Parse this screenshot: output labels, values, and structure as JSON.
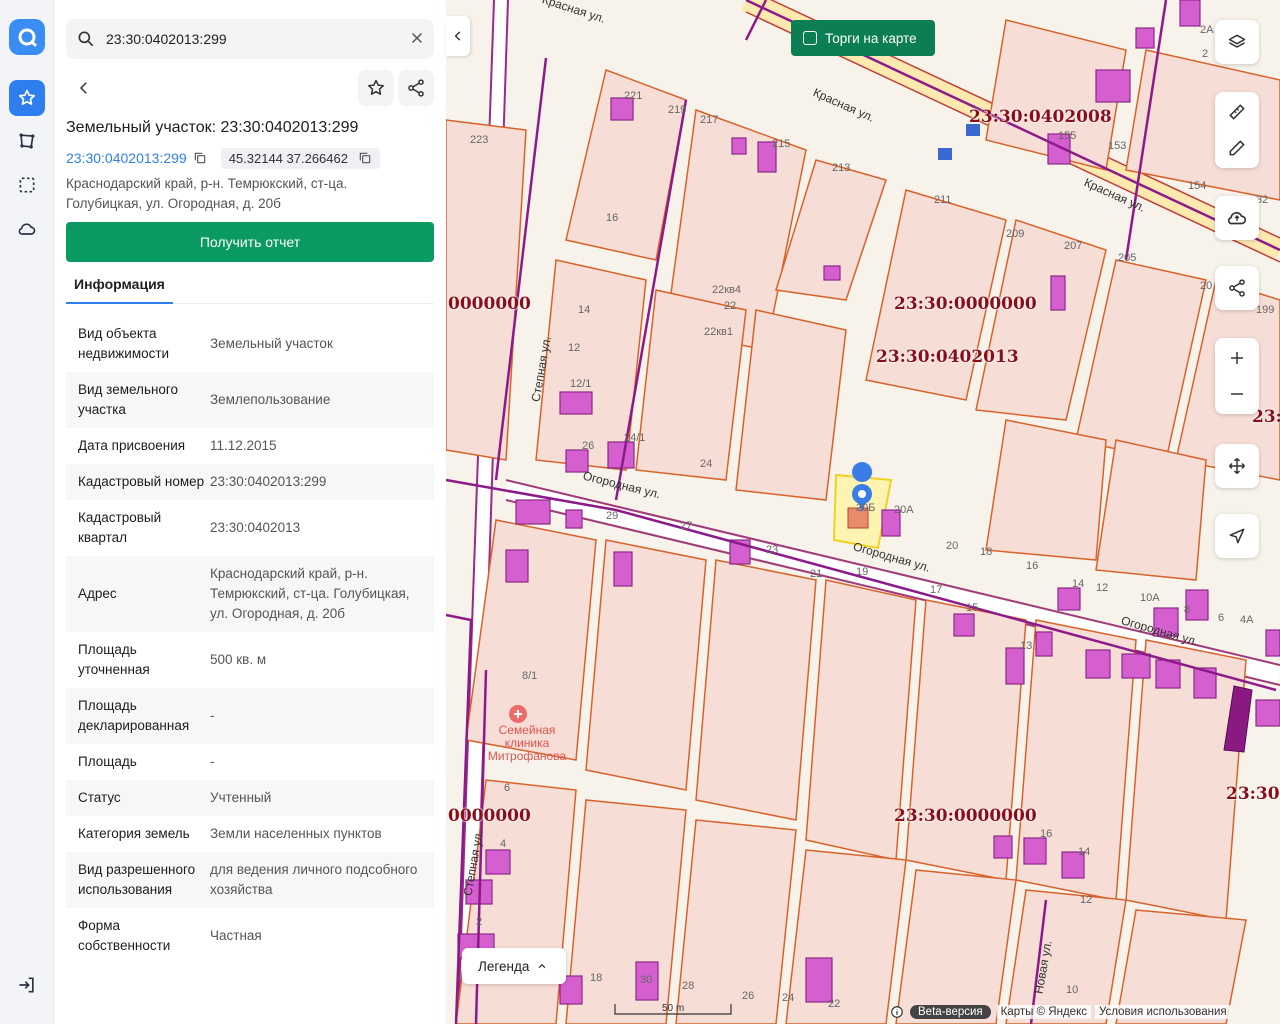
{
  "search": {
    "value": "23:30:0402013:299"
  },
  "card": {
    "title": "Земельный участок: 23:30:0402013:299",
    "cad_link": "23:30:0402013:299",
    "coords": "45.32144 37.266462",
    "address": "Краснодарский край, р-н. Темрюкский, ст-ца. Голубицкая, ул. Огородная, д. 20б",
    "report_button": "Получить отчет",
    "tab": "Информация"
  },
  "info_rows": [
    {
      "k": "Вид объекта недвижимости",
      "v": "Земельный участок"
    },
    {
      "k": "Вид земельного участка",
      "v": "Землепользование"
    },
    {
      "k": "Дата присвоения",
      "v": "11.12.2015"
    },
    {
      "k": "Кадастровый номер",
      "v": "23:30:0402013:299"
    },
    {
      "k": "Кадастровый квартал",
      "v": "23:30:0402013"
    },
    {
      "k": "Адрес",
      "v": "Краснодарский край, р-н. Темрюкский, ст-ца. Голубицкая, ул. Огородная, д. 20б"
    },
    {
      "k": "Площадь уточненная",
      "v": "500 кв. м"
    },
    {
      "k": "Площадь декларированная",
      "v": "-"
    },
    {
      "k": "Площадь",
      "v": "-"
    },
    {
      "k": "Статус",
      "v": "Учтенный"
    },
    {
      "k": "Категория земель",
      "v": "Земли населенных пунктов"
    },
    {
      "k": "Вид разрешенного использования",
      "v": "для ведения личного подсобного хозяйства"
    },
    {
      "k": "Форма собственности",
      "v": "Частная"
    }
  ],
  "map": {
    "torgi_label": "Торги на карте",
    "legend_label": "Легенда",
    "beta_label": "Beta-версия",
    "copyright": "Карты © Яндекс",
    "terms": "Условия использования",
    "scale": "50 m",
    "labels": {
      "q1": "23:30:0402008",
      "q2": "23:30:0000000",
      "q3": "23:30:0402013",
      "q4": "0000000",
      "q5": "0000000",
      "q6": "23:30:0000000",
      "q7": "23:3",
      "q8": "23:30:"
    },
    "streets": {
      "s1": "Красная ул.",
      "s2": "Красная ул.",
      "s3": "Красная ул.",
      "s4": "Огородная ул.",
      "s5": "Огородная ул.",
      "s6": "Огородная ул.",
      "s7": "Степная ул.",
      "s8": "Степная ул.",
      "s9": "Новая ул."
    },
    "poi": "Семейная клиника Митрофанова",
    "house_numbers": {
      "n223": "223",
      "n221": "221",
      "n219": "219",
      "n217": "217",
      "n215": "215",
      "n213": "213",
      "n211": "211",
      "n209": "209",
      "n207": "207",
      "n205": "205",
      "n16": "16",
      "n14": "14",
      "n12": "12",
      "n121": "12/1",
      "n26": "26",
      "n241": "24/1",
      "n24": "24",
      "n22kv4": "22кв4",
      "n22": "22",
      "n22kv1": "22кв1",
      "n20b": "20Б",
      "n20a": "20А",
      "n20": "20",
      "n18": "18",
      "n16b": "16",
      "n14b": "14",
      "n12b": "12",
      "n21": "21",
      "n19": "19",
      "n27": "27",
      "n29": "29",
      "n23": "23",
      "n81": "8/1",
      "n6": "6",
      "n4": "4",
      "n2": "2",
      "n30": "30",
      "n28": "28",
      "n26b": "26",
      "n24b": "24",
      "n22b": "22",
      "n10": "10",
      "n14c": "14",
      "n12c": "12",
      "n16c": "16",
      "n17": "17",
      "n15": "15",
      "n13": "13",
      "n10a": "10А",
      "n8": "8",
      "n6b": "6",
      "n4a": "4А",
      "n2a": "2А",
      "n2b": "2",
      "n155": "155",
      "n153": "153",
      "n154": "154",
      "n199": "199",
      "n20c": "20",
      "n32": "32",
      "n18b": "18"
    }
  }
}
